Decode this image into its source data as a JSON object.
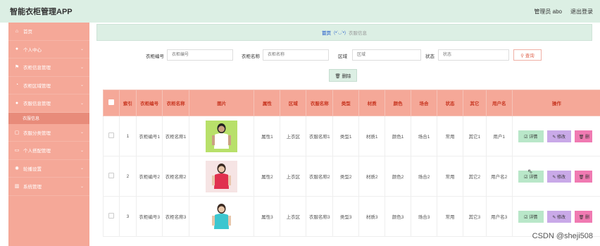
{
  "header": {
    "app_title": "智能衣柜管理APP",
    "admin_label": "管理员 abo",
    "logout_label": "退出登录"
  },
  "sidebar": {
    "items": [
      {
        "label": "首页",
        "icon": "home-icon",
        "glyph": "⌂",
        "chevron": false
      },
      {
        "label": "个人中心",
        "icon": "user-icon",
        "glyph": "●",
        "chevron": true
      },
      {
        "label": "衣柜信息管理",
        "icon": "flag-icon",
        "glyph": "⚑",
        "chevron": true
      },
      {
        "label": "衣柜区域管理",
        "icon": "bell-icon",
        "glyph": "◔",
        "chevron": true
      },
      {
        "label": "衣服信息管理",
        "icon": "user-icon",
        "glyph": "●",
        "chevron": true,
        "active": true
      },
      {
        "label": "衣服分类管理",
        "icon": "chat-icon",
        "glyph": "▢",
        "chevron": true
      },
      {
        "label": "个人搭配管理",
        "icon": "folder-icon",
        "glyph": "▭",
        "chevron": true
      },
      {
        "label": "轮播设置",
        "icon": "gear-icon",
        "glyph": "✺",
        "chevron": true
      },
      {
        "label": "系统管理",
        "icon": "chart-icon",
        "glyph": "▥",
        "chevron": true
      }
    ],
    "active_sub": "衣服信息"
  },
  "breadcrumb": {
    "home": "首页",
    "separator": "(•'◡'•)",
    "current": "衣服信息"
  },
  "search": {
    "fields": [
      {
        "label": "衣柜编号",
        "placeholder": "衣柜编号"
      },
      {
        "label": "衣柜名称",
        "placeholder": "衣柜名称"
      },
      {
        "label": "区域",
        "placeholder": "区域"
      },
      {
        "label": "状态",
        "placeholder": "状态"
      }
    ],
    "button": "⚲ 查询"
  },
  "toolbar": {
    "delete_label": "🗑 删除"
  },
  "table": {
    "headers": [
      "",
      "索引",
      "衣柜编号",
      "衣柜名称",
      "图片",
      "属性",
      "区域",
      "衣服名称",
      "类型",
      "材质",
      "颜色",
      "场合",
      "状态",
      "其它",
      "用户名",
      "操作"
    ],
    "rows": [
      {
        "index": "1",
        "cabinet_no": "衣柜编号1",
        "cabinet_name": "衣柜名称1",
        "attr": "属性1",
        "area": "上衣区",
        "cloth_name": "衣服名称1",
        "type": "类型1",
        "material": "材质1",
        "color": "颜色1",
        "occasion": "场合1",
        "status": "常用",
        "other": "其它1",
        "user": "用户1",
        "image": {
          "shirt": "#ffffff",
          "skin": "#caa182",
          "hair": "#222222",
          "bg": "#b8e06a"
        }
      },
      {
        "index": "2",
        "cabinet_no": "衣柜编号2",
        "cabinet_name": "衣柜名称2",
        "attr": "属性2",
        "area": "上衣区",
        "cloth_name": "衣服名称2",
        "type": "类型2",
        "material": "材质2",
        "color": "颜色2",
        "occasion": "场合2",
        "status": "常用",
        "other": "其它2",
        "user": "用户名2",
        "image": {
          "shirt": "#e0304e",
          "skin": "#e8c6aa",
          "hair": "#3a2a22",
          "bg": "#f6e4e4"
        }
      },
      {
        "index": "3",
        "cabinet_no": "衣柜编号3",
        "cabinet_name": "衣柜名称3",
        "attr": "属性3",
        "area": "上衣区",
        "cloth_name": "衣服名称3",
        "type": "类型3",
        "material": "材质3",
        "color": "颜色3",
        "occasion": "场合3",
        "status": "常用",
        "other": "其它3",
        "user": "用户名3",
        "image": {
          "shirt": "#3cc6cf",
          "skin": "#e8c6aa",
          "hair": "#3a2a22",
          "bg": "#ffffff"
        }
      }
    ],
    "actions": {
      "view": "☑ 详情",
      "edit": "✎ 修改",
      "delete": "🗑 删"
    }
  },
  "watermark": "CSDN @sheji508"
}
